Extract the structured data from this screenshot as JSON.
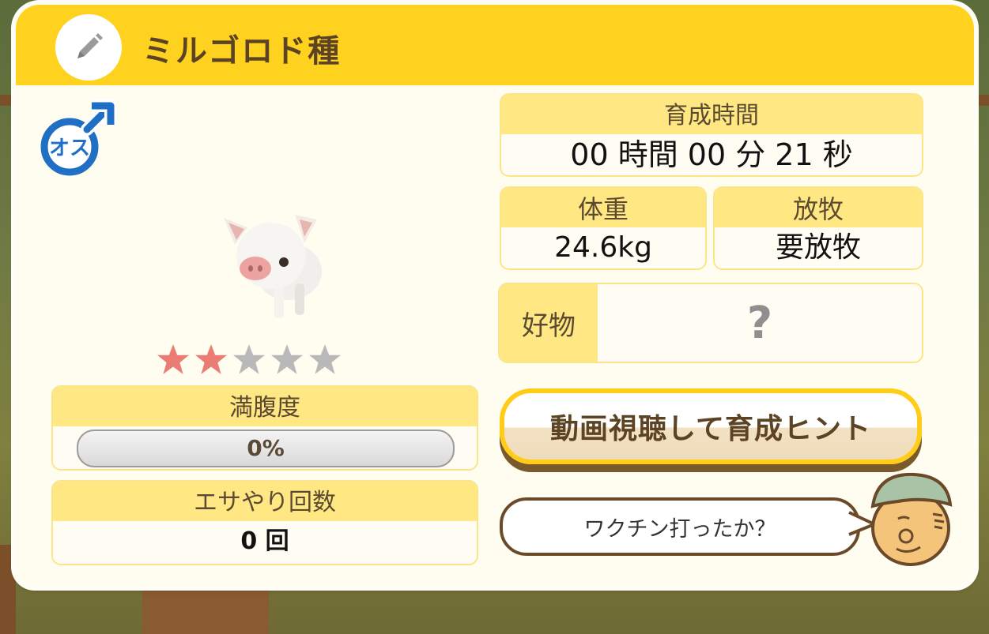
{
  "title": "ミルゴロド種",
  "sex_badge": "オス",
  "rating": {
    "value": 2,
    "max": 5,
    "filled_color": "#e97c74",
    "empty_color": "#b9b9b9"
  },
  "fullness": {
    "label": "満腹度",
    "text": "0%",
    "fraction": 0.0
  },
  "feed_count": {
    "label": "エサやり回数",
    "value": "0 回"
  },
  "growth_time": {
    "label": "育成時間",
    "value": "00 時間 00 分 21 秒"
  },
  "weight": {
    "label": "体重",
    "value": "24.6kg"
  },
  "grazing": {
    "label": "放牧",
    "value": "要放牧"
  },
  "favorite": {
    "label": "好物",
    "value": "?"
  },
  "hint_button": {
    "label": "動画視聴して育成ヒント"
  },
  "farmer_speech": "ワクチン打ったか？",
  "colors": {
    "header": "#ffd21f",
    "title_text": "#5b4323",
    "male_blue": "#1f6fc5"
  },
  "icons": {
    "edit": "pencil-icon",
    "sex": "male-symbol-icon",
    "animal": "piglet",
    "npc": "farmer-face"
  }
}
